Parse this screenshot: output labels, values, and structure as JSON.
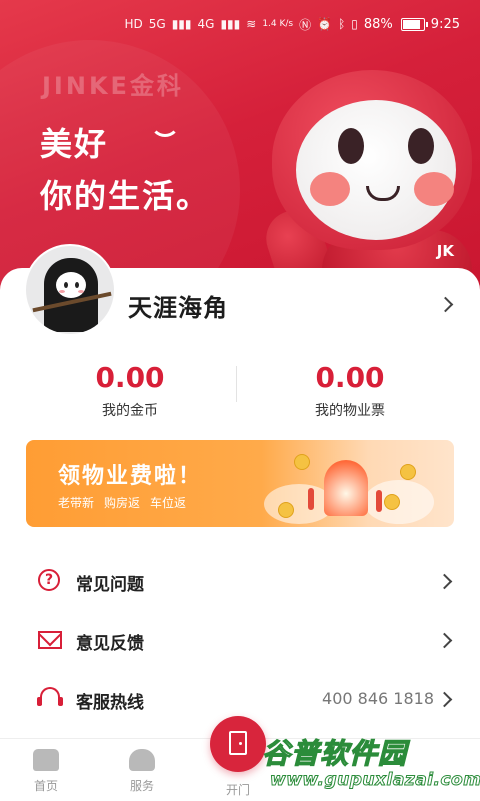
{
  "status_bar": {
    "network_left": "HD",
    "signal_1": "5G",
    "signal_2": "4G",
    "speed": "1.4 K/s",
    "battery": "88%",
    "time": "9:25"
  },
  "hero": {
    "logo": "JINKE金科",
    "slogan_line1": "美好",
    "slogan_line2": "你的生活。",
    "mascot_badge": "JK"
  },
  "profile": {
    "username": "天涯海角"
  },
  "stats": [
    {
      "value": "0.00",
      "label": "我的金币"
    },
    {
      "value": "0.00",
      "label": "我的物业票"
    }
  ],
  "promo": {
    "title": "领物业费啦！",
    "tags": [
      "老带新",
      "购房返",
      "车位返"
    ]
  },
  "menu": [
    {
      "label": "常见问题",
      "value": "",
      "icon": "question-circle-icon"
    },
    {
      "label": "意见反馈",
      "value": "",
      "icon": "envelope-icon"
    },
    {
      "label": "客服热线",
      "value": "400 846 1818",
      "icon": "headset-icon"
    }
  ],
  "bottom_nav": [
    {
      "label": "首页",
      "icon": "home-icon"
    },
    {
      "label": "服务",
      "icon": "hand-heart-icon"
    },
    {
      "label": "开门",
      "icon": "door-icon"
    }
  ],
  "watermark": {
    "main": "谷普软件园",
    "url": "www.gupuxlazai.com"
  },
  "colors": {
    "brand_red": "#d81f38",
    "promo_orange": "#ff9d34"
  }
}
